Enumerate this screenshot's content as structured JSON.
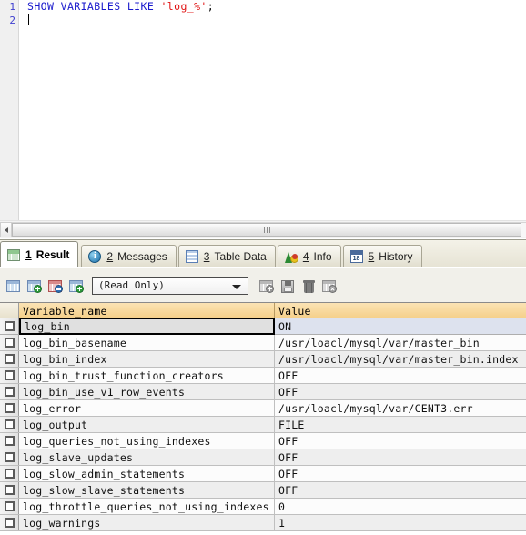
{
  "editor": {
    "lines": [
      {
        "number": "1",
        "tokens": [
          {
            "t": "SHOW VARIABLES LIKE ",
            "c": "kw"
          },
          {
            "t": "'log_%'",
            "c": "str"
          },
          {
            "t": ";",
            "c": "pun"
          }
        ]
      },
      {
        "number": "2",
        "tokens": []
      }
    ],
    "line_numbers": [
      "1",
      "2"
    ],
    "full_text": "SHOW VARIABLES LIKE 'log_%';",
    "keyword_text": "SHOW VARIABLES LIKE ",
    "string_text": "'log_%'",
    "punct_text": ";"
  },
  "hscroll": {
    "left_button_icon": "triangle-left-icon",
    "thumb_grip_icon": "grip-icon"
  },
  "tabs": [
    {
      "num": "1",
      "label": "Result",
      "icon": "result-grid-icon",
      "active": true
    },
    {
      "num": "2",
      "label": "Messages",
      "icon": "info-circle-icon",
      "active": false
    },
    {
      "num": "3",
      "label": "Table Data",
      "icon": "table-icon",
      "active": false
    },
    {
      "num": "4",
      "label": "Info",
      "icon": "chart-icon",
      "active": false
    },
    {
      "num": "5",
      "label": "History",
      "icon": "calendar-icon",
      "active": false
    }
  ],
  "result_toolbar": {
    "buttons": [
      {
        "name": "view-grid-button",
        "icon": "grid-icon",
        "enabled": true
      },
      {
        "name": "add-record-button",
        "icon": "grid-plus-icon",
        "enabled": true
      },
      {
        "name": "edit-record-button",
        "icon": "grid-edit-icon",
        "enabled": true
      },
      {
        "name": "duplicate-record-button",
        "icon": "grid-duplicate-icon",
        "enabled": true
      }
    ],
    "mode_select": {
      "value": "(Read Only)",
      "options": [
        "(Read Only)"
      ],
      "arrow_icon": "chevron-down-icon"
    },
    "right_buttons": [
      {
        "name": "insert-row-button",
        "icon": "grid-plus-icon",
        "enabled": false
      },
      {
        "name": "save-record-button",
        "icon": "floppy-disk-icon",
        "enabled": false
      },
      {
        "name": "delete-row-button",
        "icon": "trash-icon",
        "enabled": false
      },
      {
        "name": "cancel-edit-button",
        "icon": "grid-cancel-icon",
        "enabled": false
      }
    ]
  },
  "grid": {
    "columns": [
      "Variable_name",
      "Value"
    ],
    "select_all_icon": "checkbox-icon",
    "rows": [
      {
        "name": "log_bin",
        "value": "ON"
      },
      {
        "name": "log_bin_basename",
        "value": "/usr/loacl/mysql/var/master_bin"
      },
      {
        "name": "log_bin_index",
        "value": "/usr/loacl/mysql/var/master_bin.index"
      },
      {
        "name": "log_bin_trust_function_creators",
        "value": "OFF"
      },
      {
        "name": "log_bin_use_v1_row_events",
        "value": "OFF"
      },
      {
        "name": "log_error",
        "value": "/usr/loacl/mysql/var/CENT3.err"
      },
      {
        "name": "log_output",
        "value": "FILE"
      },
      {
        "name": "log_queries_not_using_indexes",
        "value": "OFF"
      },
      {
        "name": "log_slave_updates",
        "value": "OFF"
      },
      {
        "name": "log_slow_admin_statements",
        "value": "OFF"
      },
      {
        "name": "log_slow_slave_statements",
        "value": "OFF"
      },
      {
        "name": "log_throttle_queries_not_using_indexes",
        "value": "0"
      },
      {
        "name": "log_warnings",
        "value": "1"
      }
    ],
    "selected_row_index": 0
  },
  "colors": {
    "keyword": "#1919cc",
    "string": "#e01010",
    "header_gradient_top": "#fbe3b4",
    "header_gradient_bottom": "#f5cf88",
    "row_alt": "#eeeeee",
    "selection_value_bg": "#dde2ee",
    "gutter_bg": "#f0f0f0",
    "tabbar_bg": "#ece9d8"
  }
}
